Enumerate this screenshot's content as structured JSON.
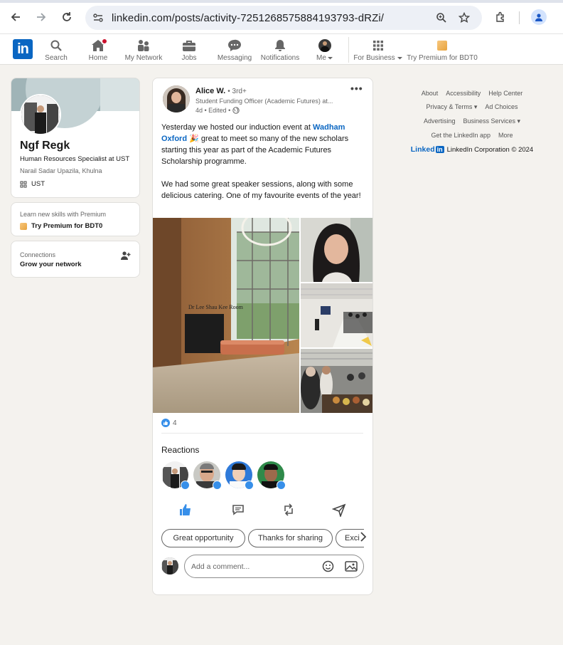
{
  "browser": {
    "url": "linkedin.com/posts/activity-7251268575884193793-dRZi/"
  },
  "nav": {
    "items": [
      {
        "label": "Search",
        "icon": "search-icon"
      },
      {
        "label": "Home",
        "icon": "home-icon"
      },
      {
        "label": "My Network",
        "icon": "network-icon"
      },
      {
        "label": "Jobs",
        "icon": "briefcase-icon"
      },
      {
        "label": "Messaging",
        "icon": "messaging-icon"
      },
      {
        "label": "Notifications",
        "icon": "bell-icon"
      },
      {
        "label": "Me",
        "icon": "avatar"
      },
      {
        "label": "For Business",
        "icon": "grid-icon"
      },
      {
        "label": "Try Premium for BDT0",
        "icon": "premium-icon"
      }
    ]
  },
  "profile": {
    "name": "Ngf Regk",
    "headline": "Human Resources Specialist at UST",
    "location": "Narail Sadar Upazila, Khulna",
    "org": "UST"
  },
  "premium_card": {
    "prompt": "Learn new skills with Premium",
    "link": "Try Premium for BDT0"
  },
  "connections_card": {
    "title": "Connections",
    "subtitle": "Grow your network"
  },
  "post": {
    "author": "Alice W.",
    "degree": "• 3rd+",
    "subtitle": "Student Funding Officer (Academic Futures) at...",
    "meta": "4d • Edited •",
    "text_1": "Yesterday we hosted our induction event at ",
    "text_link": "Wadham Oxford",
    "text_2": " 🎉 great to meet so many of the new scholars starting this year as part of the Academic Futures Scholarship programme.",
    "text_3": "We had some great speaker sessions, along with some delicious catering. One of my favourite events of the year!",
    "wall_sign": "Dr Lee Shau Kee Room",
    "reaction_count": "4",
    "reactions_title": "Reactions",
    "chips": [
      "Great opportunity",
      "Thanks for sharing",
      "Exci"
    ],
    "comment_placeholder": "Add a comment..."
  },
  "footer": {
    "row1": [
      "About",
      "Accessibility",
      "Help Center"
    ],
    "row2": [
      "Privacy & Terms ▾",
      "Ad Choices"
    ],
    "row3": [
      "Advertising",
      "Business Services ▾"
    ],
    "row4": [
      "Get the LinkedIn app",
      "More"
    ],
    "brand_text": "Linked",
    "brand_in": "in",
    "copyright": "LinkedIn Corporation © 2024"
  },
  "colors": {
    "brand": "#0a66c2",
    "background": "#f4f2ee",
    "like": "#378fe9"
  }
}
